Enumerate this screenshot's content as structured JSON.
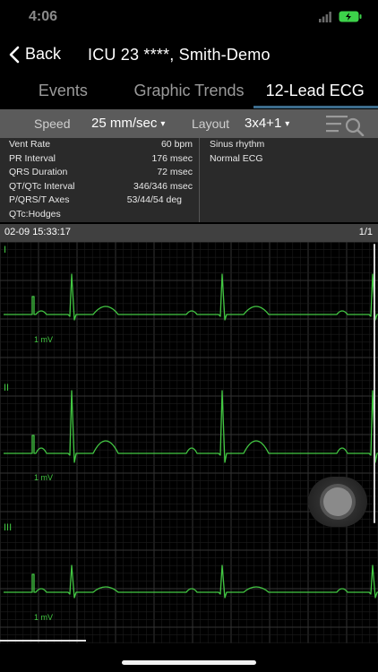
{
  "status": {
    "time": "4:06",
    "icons": [
      "signal-icon",
      "battery-charging-icon"
    ],
    "battery_color": "#3dd24a"
  },
  "nav": {
    "back_label": "Back",
    "title": "ICU 23 ****, Smith-Demo"
  },
  "tabs": [
    {
      "label": "Events",
      "active": false
    },
    {
      "label": "Graphic Trends",
      "active": false
    },
    {
      "label": "12-Lead ECG",
      "active": true
    }
  ],
  "controls": {
    "speed_label": "Speed",
    "speed_value": "25 mm/sec",
    "layout_label": "Layout",
    "layout_value": "3x4+1"
  },
  "measurements": [
    {
      "label": "Vent Rate",
      "value": "60 bpm"
    },
    {
      "label": "PR Interval",
      "value": "176 msec"
    },
    {
      "label": "QRS Duration",
      "value": "72 msec"
    },
    {
      "label": "QT/QTc Interval",
      "value": "346/346 msec"
    },
    {
      "label": "P/QRS/T Axes",
      "value": "53/44/54 deg"
    },
    {
      "label": "QTc:Hodges",
      "value": ""
    }
  ],
  "interpretation": [
    "Sinus rhythm",
    "Normal ECG"
  ],
  "record": {
    "timestamp": "02-09 15:33:17",
    "page": "1/1"
  },
  "leads": [
    {
      "name": "I",
      "calibration": "1 mV"
    },
    {
      "name": "II",
      "calibration": "1 mV"
    },
    {
      "name": "III",
      "calibration": "1 mV"
    }
  ],
  "colors": {
    "trace": "#43c843",
    "grid_minor": "#1c1c1c",
    "grid_major": "#333333",
    "accent": "#3c6c8c",
    "panel": "#2a2a2a",
    "control_bar": "#5b5b5b"
  }
}
